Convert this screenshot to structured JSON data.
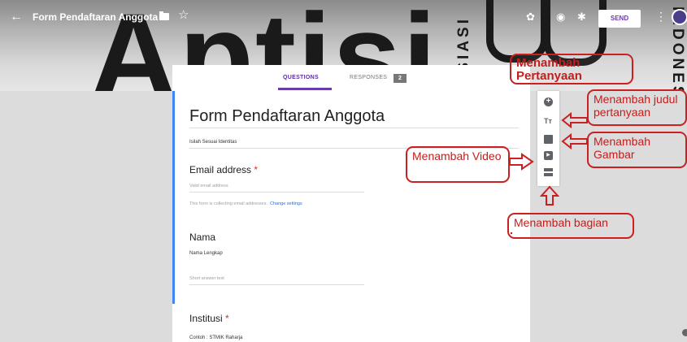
{
  "header": {
    "form_title": "Form Pendaftaran Anggota",
    "send_label": "SEND",
    "watermark_big": "Aptisi",
    "watermark_small": "ASOSIASI",
    "watermark_right": "INDONESIA",
    "watermark_box": "LU"
  },
  "tabs": {
    "questions": "QUESTIONS",
    "responses": "RESPONSES",
    "responses_count": "2"
  },
  "form": {
    "title": "Form Pendaftaran Anggota",
    "description": "Isilah Sesuai Identitas",
    "questions": [
      {
        "label": "Email address",
        "required": true,
        "placeholder": "Valid email address"
      },
      {
        "label": "Nama",
        "required": false,
        "hint": "Nama Lengkap",
        "placeholder": "Short answer text"
      },
      {
        "label": "Institusi",
        "required": true,
        "hint": "Contoh : STMIK Raharja"
      }
    ],
    "email_note": "This form is collecting email addresses.",
    "change_settings": "Change settings"
  },
  "annotations": {
    "add_question": "Menambah Pertanyaan",
    "add_title": "Menambah judul pertanyaan",
    "add_image": "Menambah Gambar",
    "add_video": "Menambah Video",
    "add_section": "Menambah bagian"
  },
  "colors": {
    "accent": "#6a3cab",
    "callout": "#cc1f1f",
    "card_accent": "#4285f4"
  }
}
